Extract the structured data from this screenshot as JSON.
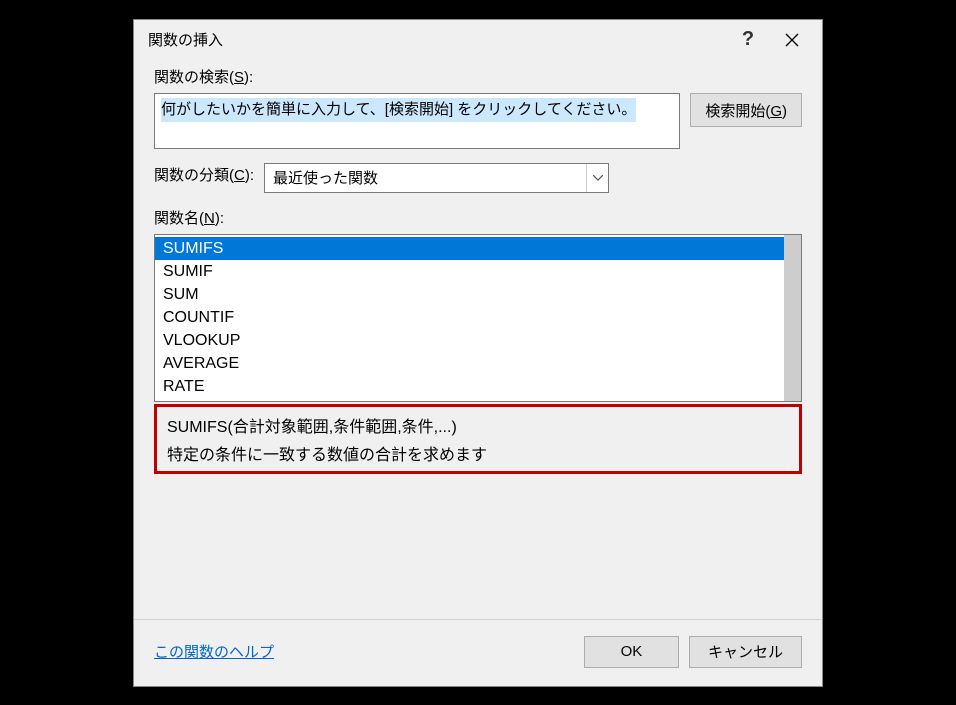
{
  "titlebar": {
    "title": "関数の挿入",
    "help": "?",
    "close": "✕"
  },
  "search": {
    "label_prefix": "関数の検索(",
    "label_key": "S",
    "label_suffix": "):",
    "text": "何がしたいかを簡単に入力して、[検索開始] をクリックしてください。",
    "button_prefix": "検索開始(",
    "button_key": "G",
    "button_suffix": ")"
  },
  "category": {
    "label_prefix": "関数の分類(",
    "label_key": "C",
    "label_suffix": "):",
    "value": "最近使った関数"
  },
  "funcname": {
    "label_prefix": "関数名(",
    "label_key": "N",
    "label_suffix": "):"
  },
  "functions": [
    {
      "name": "SUMIFS",
      "selected": true
    },
    {
      "name": "SUMIF",
      "selected": false
    },
    {
      "name": "SUM",
      "selected": false
    },
    {
      "name": "COUNTIF",
      "selected": false
    },
    {
      "name": "VLOOKUP",
      "selected": false
    },
    {
      "name": "AVERAGE",
      "selected": false
    },
    {
      "name": "RATE",
      "selected": false
    }
  ],
  "description": {
    "syntax": "SUMIFS(合計対象範囲,条件範囲,条件,...)",
    "text": "特定の条件に一致する数値の合計を求めます"
  },
  "footer": {
    "help_link": "この関数のヘルプ",
    "ok": "OK",
    "cancel": "キャンセル"
  }
}
